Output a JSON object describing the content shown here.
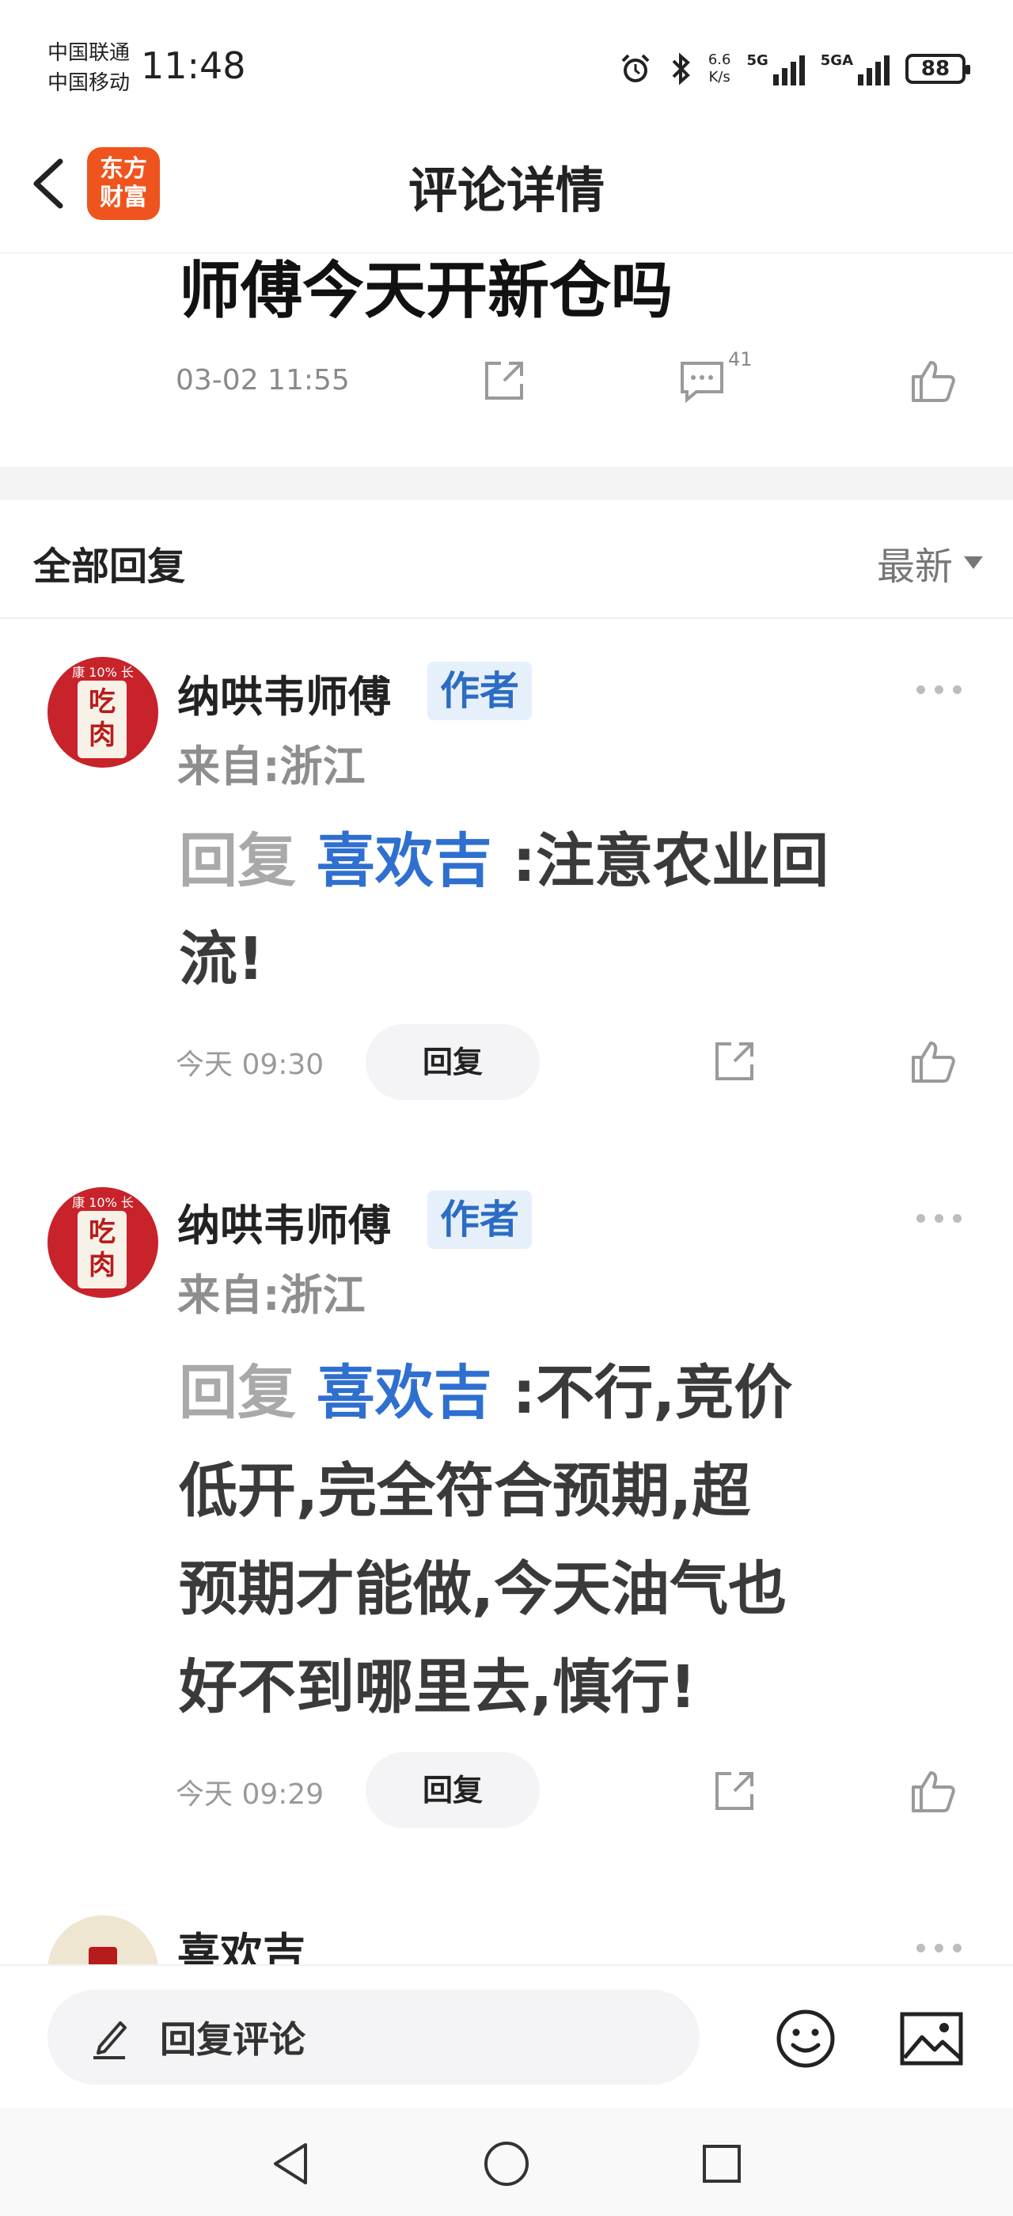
{
  "status_bar": {
    "carrier_1": "中国联通",
    "carrier_2": "中国移动",
    "time": "11:48",
    "net_speed_value": "6.6",
    "net_speed_unit": "K/s",
    "signal_1": "5G",
    "signal_2": "5GA",
    "battery": "88"
  },
  "header": {
    "logo_line_1": "东方",
    "logo_line_2": "财富",
    "title": "评论详情"
  },
  "post": {
    "title": "师傅今天开新仓吗",
    "date": "03-02 11:55",
    "comment_count": "41"
  },
  "replies_section": {
    "title": "全部回复",
    "sort_label": "最新"
  },
  "replies": [
    {
      "user": "纳哄韦师傅",
      "badge": "作者",
      "location": "来自:浙江",
      "reply_prefix": "回复",
      "mention": "喜欢吉",
      "line_1": ":注意农业回",
      "line_2": "流!",
      "time": "今天 09:30",
      "reply_button": "回复"
    },
    {
      "user": "纳哄韦师傅",
      "badge": "作者",
      "location": "来自:浙江",
      "reply_prefix": "回复",
      "mention": "喜欢吉",
      "line_1": ":不行,竞价",
      "line_2": "低开,完全符合预期,超",
      "line_3": "预期才能做,今天油气也",
      "line_4": "好不到哪里去,慎行!",
      "time": "今天 09:29",
      "reply_button": "回复"
    },
    {
      "user": "喜欢吉"
    }
  ],
  "avatar": {
    "sign_text": "吃肉",
    "top_text": "康 10% 长"
  },
  "bottom_bar": {
    "input_placeholder": "回复评论"
  },
  "colors": {
    "accent_blue": "#2f6fd0",
    "brand_orange": "#f0541e",
    "badge_bg": "#e6f0fb"
  }
}
